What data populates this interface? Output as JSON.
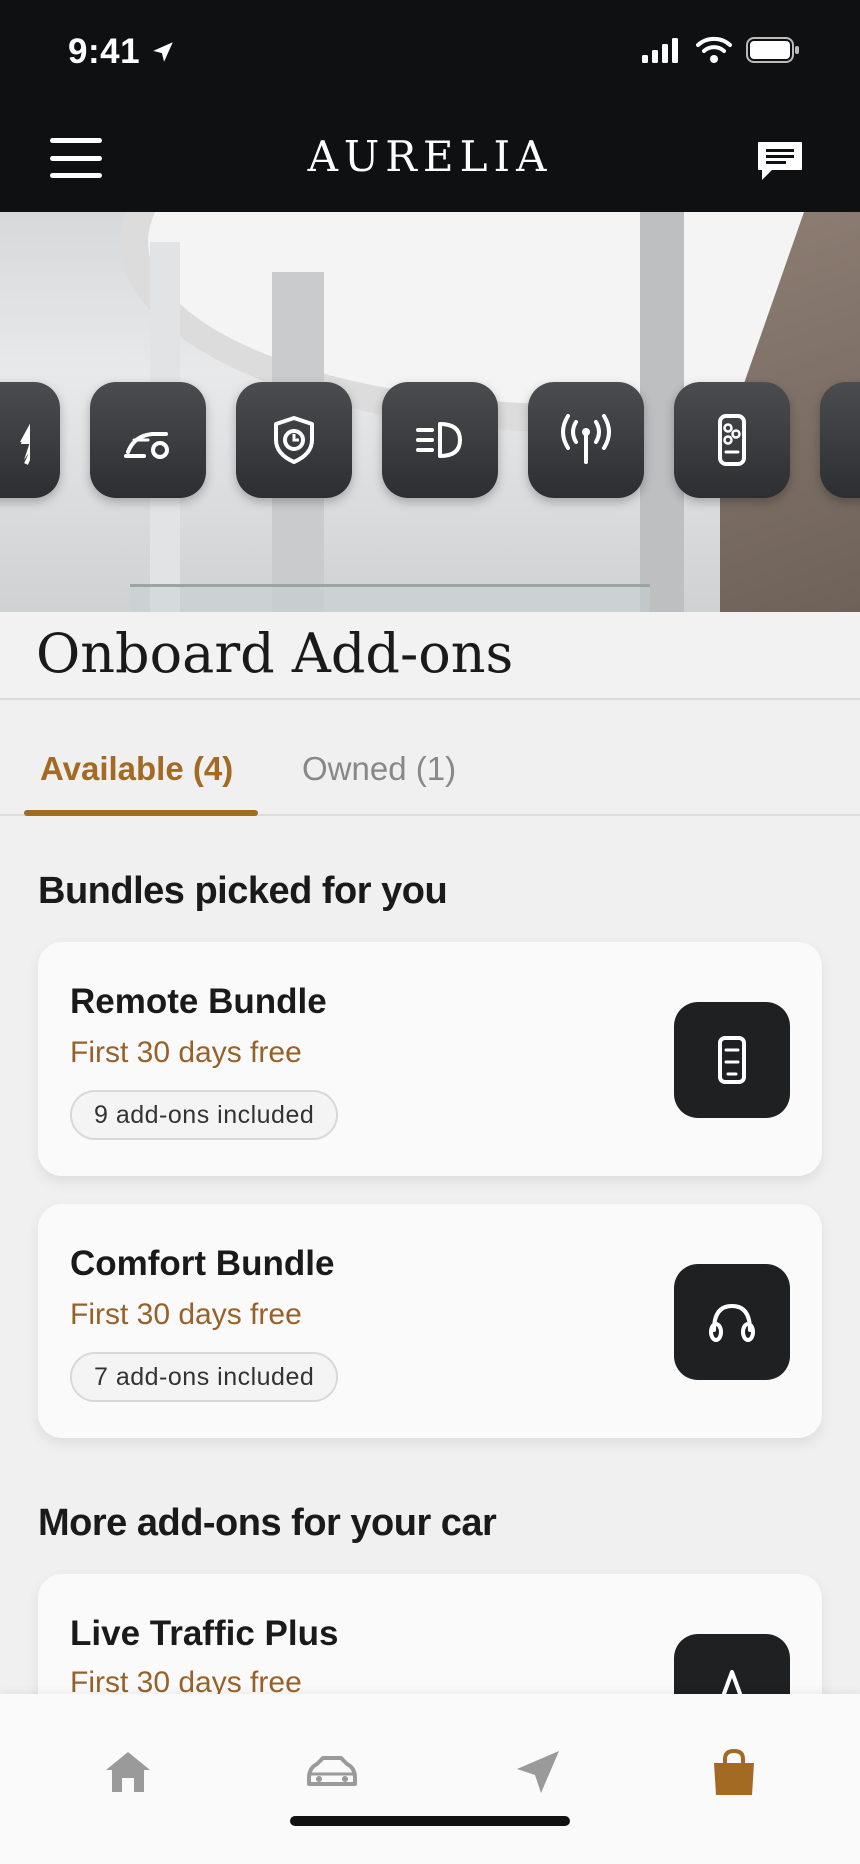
{
  "status_bar": {
    "time": "9:41"
  },
  "header": {
    "title": "AURELIA"
  },
  "page": {
    "title": "Onboard Add-ons"
  },
  "tabs": [
    {
      "label": "Available (4)",
      "active": true
    },
    {
      "label": "Owned (1)",
      "active": false
    }
  ],
  "bundles_section": {
    "title": "Bundles picked for you",
    "cards": [
      {
        "title": "Remote Bundle",
        "subtitle": "First 30 days free",
        "pill": "9 add-ons included",
        "icon": "phone-remote-icon"
      },
      {
        "title": "Comfort Bundle",
        "subtitle": "First 30 days free",
        "pill": "7 add-ons included",
        "icon": "headphones-icon"
      }
    ]
  },
  "more_section": {
    "title": "More add-ons for your car",
    "cards": [
      {
        "title": "Live Traffic Plus",
        "subtitle": "First 30 days free",
        "icon": "navigation-icon"
      }
    ]
  },
  "hero_icons": [
    "charging-icon",
    "speedometer-icon",
    "security-shield-icon",
    "headlight-icon",
    "antenna-icon",
    "remote-key-icon",
    "more-icon"
  ],
  "bottom_nav": [
    "home-icon",
    "car-icon",
    "navigation-icon",
    "shop-bag-icon"
  ],
  "colors": {
    "accent": "#a36a24",
    "header_bg": "#0f1012",
    "tile_bg": "#2c2e31"
  }
}
